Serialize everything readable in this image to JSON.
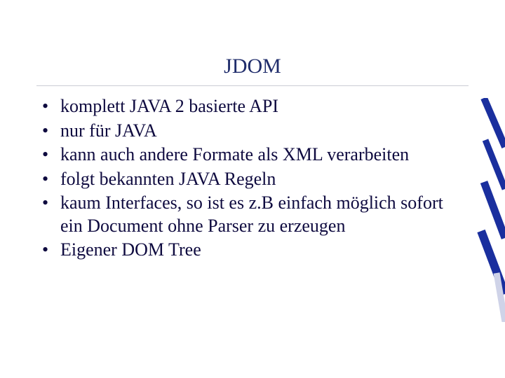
{
  "title": "JDOM",
  "bullets": [
    "komplett JAVA 2 basierte API",
    "nur für JAVA",
    "kann auch andere Formate als XML verarbeiten",
    "folgt bekannten JAVA Regeln",
    "kaum Interfaces, so ist es z.B einfach möglich sofort ein Document ohne Parser zu erzeugen",
    "Eigener DOM Tree"
  ]
}
